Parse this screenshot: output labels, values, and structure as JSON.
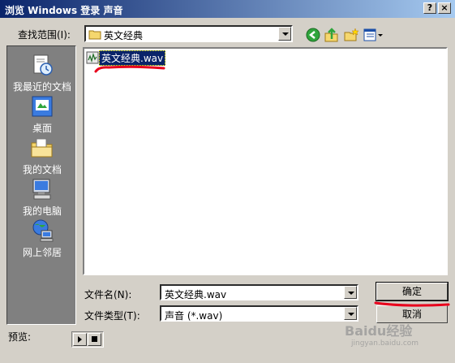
{
  "window": {
    "title": "浏览 Windows 登录 声音",
    "help_btn": "?",
    "close_btn": "×"
  },
  "lookin": {
    "label": "查找范围(I):",
    "value": "英文经典"
  },
  "places": [
    {
      "label": "我最近的文档",
      "icon": "recent-docs-icon"
    },
    {
      "label": "桌面",
      "icon": "desktop-icon"
    },
    {
      "label": "我的文档",
      "icon": "my-documents-icon"
    },
    {
      "label": "我的电脑",
      "icon": "my-computer-icon"
    },
    {
      "label": "网上邻居",
      "icon": "network-places-icon"
    }
  ],
  "files": [
    {
      "name": "英文经典.wav",
      "icon": "wav-file-icon",
      "selected": true
    }
  ],
  "filename": {
    "label": "文件名(N):",
    "value": "英文经典.wav"
  },
  "filetype": {
    "label": "文件类型(T):",
    "value": "声音 (*.wav)"
  },
  "buttons": {
    "ok": "确定",
    "cancel": "取消"
  },
  "preview": {
    "label": "预览:"
  },
  "watermark": {
    "text": "Baidu经验",
    "sub": "jingyan.baidu.com"
  },
  "colors": {
    "titlebar": "#0a246a",
    "face": "#d4d0c8",
    "places_bg": "#808080",
    "annotation": "#e8001c"
  }
}
